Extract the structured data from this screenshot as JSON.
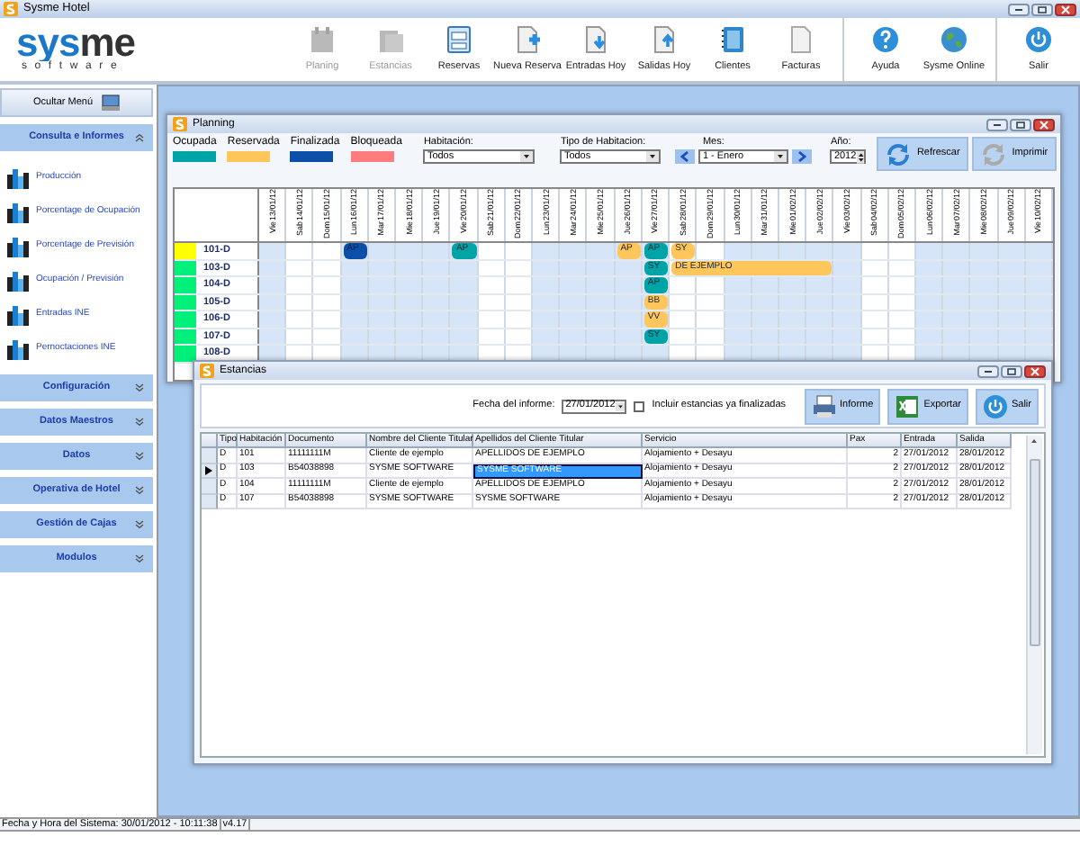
{
  "window": {
    "title": "Sysme Hotel"
  },
  "logo": {
    "name": "sysme",
    "tagline": "software"
  },
  "toolbar": [
    {
      "items": [
        {
          "label": "Planing",
          "kind": "calendar",
          "disabled": true
        },
        {
          "label": "Estancias",
          "kind": "folder",
          "disabled": true
        },
        {
          "label": "Reservas",
          "kind": "cabinet",
          "disabled": false
        },
        {
          "label": "Nueva Reserva",
          "kind": "docplus",
          "disabled": false
        },
        {
          "label": "Entradas Hoy",
          "kind": "docin",
          "disabled": false
        },
        {
          "label": "Salidas Hoy",
          "kind": "docout",
          "disabled": false
        },
        {
          "label": "Clientes",
          "kind": "book",
          "disabled": false
        },
        {
          "label": "Facturas",
          "kind": "doc",
          "disabled": false
        }
      ]
    },
    {
      "items": [
        {
          "label": "Ayuda",
          "kind": "help",
          "disabled": false
        },
        {
          "label": "Sysme Online",
          "kind": "globe",
          "disabled": false
        }
      ]
    },
    {
      "items": [
        {
          "label": "Salir",
          "kind": "power",
          "disabled": false
        }
      ]
    }
  ],
  "sidebar": {
    "hide_menu": "Ocultar Menú",
    "sections": [
      {
        "label": "Consulta e Informes",
        "expanded": true,
        "children": [
          {
            "label": "Producción"
          },
          {
            "label": "Porcentage de Ocupación"
          },
          {
            "label": "Porcentage de Previsión"
          },
          {
            "label": "Ocupación / Previsión"
          },
          {
            "label": "Entradas INE"
          },
          {
            "label": "Pernoctaciones INE"
          }
        ]
      },
      {
        "label": "Configuración",
        "expanded": false
      },
      {
        "label": "Datos Maestros",
        "expanded": false
      },
      {
        "label": "Datos",
        "expanded": false
      },
      {
        "label": "Operativa de Hotel",
        "expanded": false
      },
      {
        "label": "Gestión de Cajas",
        "expanded": false
      },
      {
        "label": "Modulos",
        "expanded": false
      }
    ]
  },
  "planning": {
    "title": "Planning",
    "legend": [
      {
        "label": "Ocupada",
        "color": "#00a3a6"
      },
      {
        "label": "Reservada",
        "color": "#ffc65c"
      },
      {
        "label": "Finalizada",
        "color": "#0b4fa8"
      },
      {
        "label": "Bloqueada",
        "color": "#ff7c7c"
      }
    ],
    "habitacion": {
      "label": "Habitación:",
      "value": "Todos"
    },
    "tipo": {
      "label": "Tipo de Habitacion:",
      "value": "Todos"
    },
    "mes": {
      "label": "Mes:",
      "value": "1 - Enero"
    },
    "anio": {
      "label": "Año:",
      "value": "2012"
    },
    "buttons": [
      {
        "label": "Refrescar",
        "kind": "refresh"
      },
      {
        "label": "Imprimir",
        "kind": "print"
      }
    ],
    "days": [
      {
        "day": "Vie",
        "date": "13/01/12",
        "weekend": false
      },
      {
        "day": "Sab",
        "date": "14/01/12",
        "weekend": true
      },
      {
        "day": "Dom",
        "date": "15/01/12",
        "weekend": true
      },
      {
        "day": "Lun",
        "date": "16/01/12",
        "weekend": false
      },
      {
        "day": "Mar",
        "date": "17/01/12",
        "weekend": false
      },
      {
        "day": "Mie",
        "date": "18/01/12",
        "weekend": false
      },
      {
        "day": "Jue",
        "date": "19/01/12",
        "weekend": false
      },
      {
        "day": "Vie",
        "date": "20/01/12",
        "weekend": false
      },
      {
        "day": "Sab",
        "date": "21/01/12",
        "weekend": true
      },
      {
        "day": "Dom",
        "date": "22/01/12",
        "weekend": true
      },
      {
        "day": "Lun",
        "date": "23/01/12",
        "weekend": false
      },
      {
        "day": "Mar",
        "date": "24/01/12",
        "weekend": false
      },
      {
        "day": "Mie",
        "date": "25/01/12",
        "weekend": false
      },
      {
        "day": "Jue",
        "date": "26/01/12",
        "weekend": false
      },
      {
        "day": "Vie",
        "date": "27/01/12",
        "weekend": false
      },
      {
        "day": "Sab",
        "date": "28/01/12",
        "weekend": true
      },
      {
        "day": "Dom",
        "date": "29/01/12",
        "weekend": true
      },
      {
        "day": "Lun",
        "date": "30/01/12",
        "weekend": false
      },
      {
        "day": "Mar",
        "date": "31/01/12",
        "weekend": false
      },
      {
        "day": "Mie",
        "date": "01/02/12",
        "weekend": false
      },
      {
        "day": "Jue",
        "date": "02/02/12",
        "weekend": false
      },
      {
        "day": "Vie",
        "date": "03/02/12",
        "weekend": false
      },
      {
        "day": "Sab",
        "date": "04/02/12",
        "weekend": true
      },
      {
        "day": "Dom",
        "date": "05/02/12",
        "weekend": true
      },
      {
        "day": "Lun",
        "date": "06/02/12",
        "weekend": false
      },
      {
        "day": "Mar",
        "date": "07/02/12",
        "weekend": false
      },
      {
        "day": "Mie",
        "date": "08/02/12",
        "weekend": false
      },
      {
        "day": "Jue",
        "date": "09/02/12",
        "weekend": false
      },
      {
        "day": "Vie",
        "date": "10/02/12",
        "weekend": false
      }
    ],
    "rooms": [
      {
        "label": "101-D",
        "color": "#ffff00",
        "slots": [
          {
            "kind": "free"
          },
          {
            "kind": "free"
          },
          {
            "kind": "free"
          },
          {
            "kind": "booking",
            "label": "AP",
            "color": "#0b4fa8"
          },
          {
            "kind": "free"
          },
          {
            "kind": "free"
          },
          {
            "kind": "free"
          },
          {
            "kind": "booking",
            "label": "AP",
            "color": "#00a3a6"
          },
          {
            "kind": "free"
          },
          {
            "kind": "free"
          },
          {
            "kind": "free"
          },
          {
            "kind": "free"
          },
          {
            "kind": "free"
          },
          {
            "kind": "booking",
            "label": "AP",
            "color": "#ffc65c"
          },
          {
            "kind": "booking",
            "label": "AP",
            "color": "#00a3a6"
          },
          {
            "kind": "booking",
            "label": "SY",
            "color": "#ffc65c"
          }
        ]
      },
      {
        "label": "103-D",
        "color": "#00f07a",
        "slots": [
          {
            "kind": "free"
          },
          {
            "kind": "free"
          },
          {
            "kind": "free"
          },
          {
            "kind": "free"
          },
          {
            "kind": "free"
          },
          {
            "kind": "free"
          },
          {
            "kind": "free"
          },
          {
            "kind": "free"
          },
          {
            "kind": "free"
          },
          {
            "kind": "free"
          },
          {
            "kind": "free"
          },
          {
            "kind": "free"
          },
          {
            "kind": "free"
          },
          {
            "kind": "free"
          },
          {
            "kind": "booking",
            "label": "SY",
            "color": "#00a3a6"
          },
          {
            "kind": "booking",
            "label": "DE EJEMPLO",
            "color": "#ffc65c"
          },
          {
            "kind": "continued"
          },
          {
            "kind": "continued"
          },
          {
            "kind": "continued"
          },
          {
            "kind": "continued"
          },
          {
            "kind": "continued"
          }
        ]
      },
      {
        "label": "104-D",
        "color": "#00f07a",
        "slots": [
          {
            "kind": "free"
          },
          {
            "kind": "free"
          },
          {
            "kind": "free"
          },
          {
            "kind": "free"
          },
          {
            "kind": "free"
          },
          {
            "kind": "free"
          },
          {
            "kind": "free"
          },
          {
            "kind": "free"
          },
          {
            "kind": "free"
          },
          {
            "kind": "free"
          },
          {
            "kind": "free"
          },
          {
            "kind": "free"
          },
          {
            "kind": "free"
          },
          {
            "kind": "free"
          },
          {
            "kind": "booking",
            "label": "AP",
            "color": "#00a3a6"
          }
        ]
      },
      {
        "label": "105-D",
        "color": "#00f07a",
        "slots": [
          {
            "kind": "free"
          },
          {
            "kind": "free"
          },
          {
            "kind": "free"
          },
          {
            "kind": "free"
          },
          {
            "kind": "free"
          },
          {
            "kind": "free"
          },
          {
            "kind": "free"
          },
          {
            "kind": "free"
          },
          {
            "kind": "free"
          },
          {
            "kind": "free"
          },
          {
            "kind": "free"
          },
          {
            "kind": "free"
          },
          {
            "kind": "free"
          },
          {
            "kind": "free"
          },
          {
            "kind": "booking",
            "label": "BB",
            "color": "#ffc65c"
          }
        ]
      },
      {
        "label": "106-D",
        "color": "#00f07a",
        "slots": [
          {
            "kind": "free"
          },
          {
            "kind": "free"
          },
          {
            "kind": "free"
          },
          {
            "kind": "free"
          },
          {
            "kind": "free"
          },
          {
            "kind": "free"
          },
          {
            "kind": "free"
          },
          {
            "kind": "free"
          },
          {
            "kind": "free"
          },
          {
            "kind": "free"
          },
          {
            "kind": "free"
          },
          {
            "kind": "free"
          },
          {
            "kind": "free"
          },
          {
            "kind": "free"
          },
          {
            "kind": "booking",
            "label": "VV",
            "color": "#ffc65c"
          }
        ]
      },
      {
        "label": "107-D",
        "color": "#00f07a",
        "slots": [
          {
            "kind": "free"
          },
          {
            "kind": "free"
          },
          {
            "kind": "free"
          },
          {
            "kind": "free"
          },
          {
            "kind": "free"
          },
          {
            "kind": "free"
          },
          {
            "kind": "free"
          },
          {
            "kind": "free"
          },
          {
            "kind": "free"
          },
          {
            "kind": "free"
          },
          {
            "kind": "free"
          },
          {
            "kind": "free"
          },
          {
            "kind": "free"
          },
          {
            "kind": "free"
          },
          {
            "kind": "booking",
            "label": "SY",
            "color": "#00a3a6"
          }
        ]
      },
      {
        "label": "108-D",
        "color": "#00f07a"
      }
    ]
  },
  "estancias": {
    "title": "Estancias",
    "fecha": {
      "label": "Fecha del informe:",
      "value": "27/01/2012"
    },
    "incluir": {
      "label": "Incluir estancias ya finalizadas",
      "checked": false
    },
    "buttons": [
      {
        "label": "Informe",
        "kind": "printer"
      },
      {
        "label": "Exportar",
        "kind": "sheet"
      },
      {
        "label": "Salir",
        "kind": "power"
      }
    ],
    "columns": [
      {
        "label": "Tipo",
        "kind": "text"
      },
      {
        "label": "Habitación",
        "kind": "text"
      },
      {
        "label": "Documento",
        "kind": "text"
      },
      {
        "label": "Nombre del Cliente Titular",
        "kind": "text"
      },
      {
        "label": "Apellidos del Cliente Titular",
        "kind": "text"
      },
      {
        "label": "Servicio",
        "kind": "text"
      },
      {
        "label": "Pax",
        "kind": "number"
      },
      {
        "label": "Entrada",
        "kind": "text"
      },
      {
        "label": "Salida",
        "kind": "text"
      }
    ],
    "rows": [
      {
        "selected": false,
        "cells": [
          {
            "text": "D",
            "selected": false
          },
          {
            "text": "101",
            "selected": false
          },
          {
            "text": "11111111M",
            "selected": false
          },
          {
            "text": "Cliente de ejemplo",
            "selected": false
          },
          {
            "text": "APELLIDOS DE EJEMPLO",
            "selected": false
          },
          {
            "text": "Alojamiento + Desayu",
            "selected": false
          },
          {
            "text": "2",
            "selected": false
          },
          {
            "text": "27/01/2012",
            "selected": false
          },
          {
            "text": "28/01/2012",
            "selected": false
          }
        ]
      },
      {
        "selected": true,
        "cells": [
          {
            "text": "D",
            "selected": false
          },
          {
            "text": "103",
            "selected": false
          },
          {
            "text": "B54038898",
            "selected": false
          },
          {
            "text": "SYSME SOFTWARE",
            "selected": false
          },
          {
            "text": "SYSME SOFTWARE",
            "selected": true
          },
          {
            "text": "Alojamiento + Desayu",
            "selected": false
          },
          {
            "text": "2",
            "selected": false
          },
          {
            "text": "27/01/2012",
            "selected": false
          },
          {
            "text": "28/01/2012",
            "selected": false
          }
        ]
      },
      {
        "selected": false,
        "cells": [
          {
            "text": "D",
            "selected": false
          },
          {
            "text": "104",
            "selected": false
          },
          {
            "text": "11111111M",
            "selected": false
          },
          {
            "text": "Cliente de ejemplo",
            "selected": false
          },
          {
            "text": "APELLIDOS DE EJEMPLO",
            "selected": false
          },
          {
            "text": "Alojamiento + Desayu",
            "selected": false
          },
          {
            "text": "2",
            "selected": false
          },
          {
            "text": "27/01/2012",
            "selected": false
          },
          {
            "text": "28/01/2012",
            "selected": false
          }
        ]
      },
      {
        "selected": false,
        "cells": [
          {
            "text": "D",
            "selected": false
          },
          {
            "text": "107",
            "selected": false
          },
          {
            "text": "B54038898",
            "selected": false
          },
          {
            "text": "SYSME SOFTWARE",
            "selected": false
          },
          {
            "text": "SYSME SOFTWARE",
            "selected": false
          },
          {
            "text": "Alojamiento + Desayu",
            "selected": false
          },
          {
            "text": "2",
            "selected": false
          },
          {
            "text": "27/01/2012",
            "selected": false
          },
          {
            "text": "28/01/2012",
            "selected": false
          }
        ]
      }
    ]
  },
  "status_bar": {
    "datetime": "Fecha y Hora del Sistema: 30/01/2012 - 10:11:38",
    "version": "v4.17"
  }
}
